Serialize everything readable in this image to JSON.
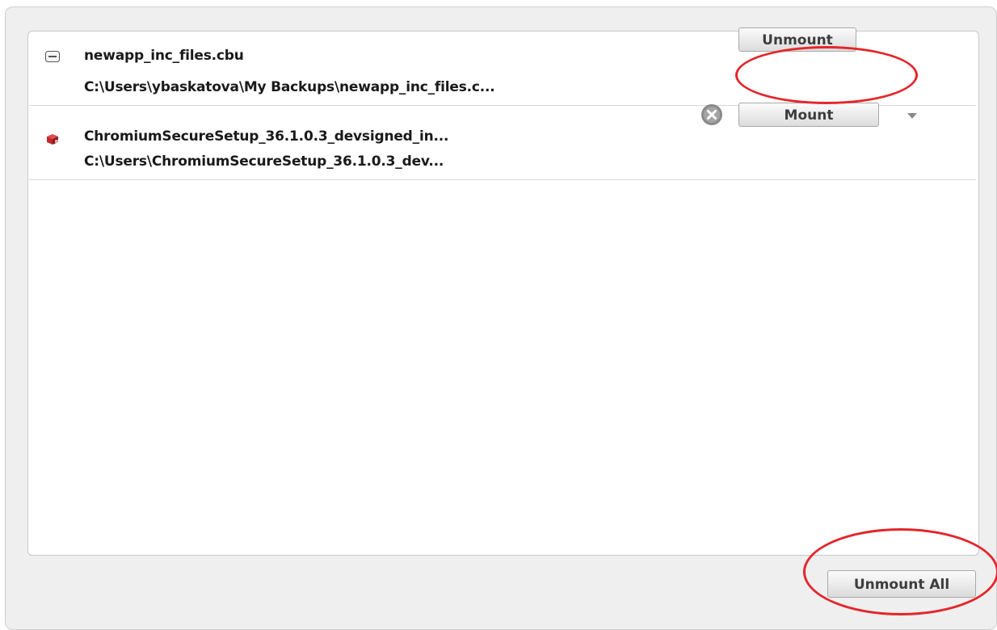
{
  "items": [
    {
      "name": "newapp_inc_files.cbu",
      "path": "C:\\Users\\ybaskatova\\My Backups\\newapp_inc_files.c...",
      "icon": "drive-icon",
      "action_label": "Unmount"
    },
    {
      "name": "ChromiumSecureSetup_36.1.0.3_devsigned_in...",
      "path": "C:\\Users\\ChromiumSecureSetup_36.1.0.3_dev...",
      "icon": "package-icon",
      "action_label": "Mount"
    }
  ],
  "footer": {
    "unmount_all_label": "Unmount All"
  },
  "colors": {
    "annotation": "#e5252a",
    "package_icon": "#c0292b"
  }
}
